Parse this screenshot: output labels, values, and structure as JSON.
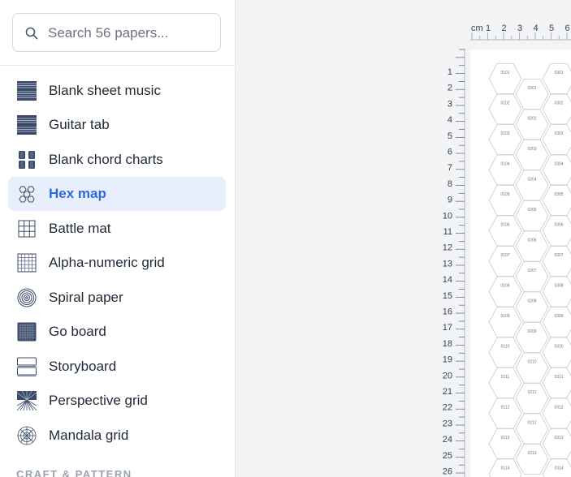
{
  "search": {
    "placeholder": "Search 56 papers..."
  },
  "sidebar": {
    "items": [
      {
        "label": "Blank sheet music",
        "icon": "sheet-music-icon"
      },
      {
        "label": "Guitar tab",
        "icon": "guitar-tab-icon"
      },
      {
        "label": "Blank chord charts",
        "icon": "chord-chart-icon"
      },
      {
        "label": "Hex map",
        "icon": "hex-icon",
        "active": true
      },
      {
        "label": "Battle mat",
        "icon": "grid-icon"
      },
      {
        "label": "Alpha-numeric grid",
        "icon": "fine-grid-icon"
      },
      {
        "label": "Spiral paper",
        "icon": "spiral-icon"
      },
      {
        "label": "Go board",
        "icon": "go-board-icon"
      },
      {
        "label": "Storyboard",
        "icon": "storyboard-icon"
      },
      {
        "label": "Perspective grid",
        "icon": "perspective-icon"
      },
      {
        "label": "Mandala grid",
        "icon": "mandala-icon"
      }
    ],
    "section_heading": "CRAFT & PATTERN"
  },
  "preview": {
    "ruler_unit": "cm",
    "top_ruler_labels": [
      "1",
      "2",
      "3",
      "4",
      "5",
      "6"
    ],
    "side_ruler_labels": [
      "1",
      "2",
      "3",
      "4",
      "5",
      "6",
      "7",
      "8",
      "9",
      "10",
      "11",
      "12",
      "13",
      "14",
      "15",
      "16",
      "17",
      "18",
      "19",
      "20",
      "21",
      "22",
      "23",
      "24",
      "25",
      "26"
    ],
    "hex_columns": [
      [
        "0101",
        "0102",
        "0103",
        "0104",
        "0105",
        "0106",
        "0107",
        "0108",
        "0109",
        "0110",
        "0111",
        "0112",
        "0113",
        "0114"
      ],
      [
        "0201",
        "0202",
        "0203",
        "0204",
        "0205",
        "0206",
        "0207",
        "0208",
        "0209",
        "0210",
        "0211",
        "0212",
        "0213"
      ],
      [
        "0301",
        "0302",
        "0303",
        "0304",
        "0305",
        "0306",
        "0307",
        "0308",
        "0309",
        "0310",
        "0311",
        "0312",
        "0313",
        "0314"
      ]
    ]
  },
  "colors": {
    "accent": "#2f6bd8",
    "active_bg": "#e8eefb",
    "icon": "#3b4a68"
  }
}
